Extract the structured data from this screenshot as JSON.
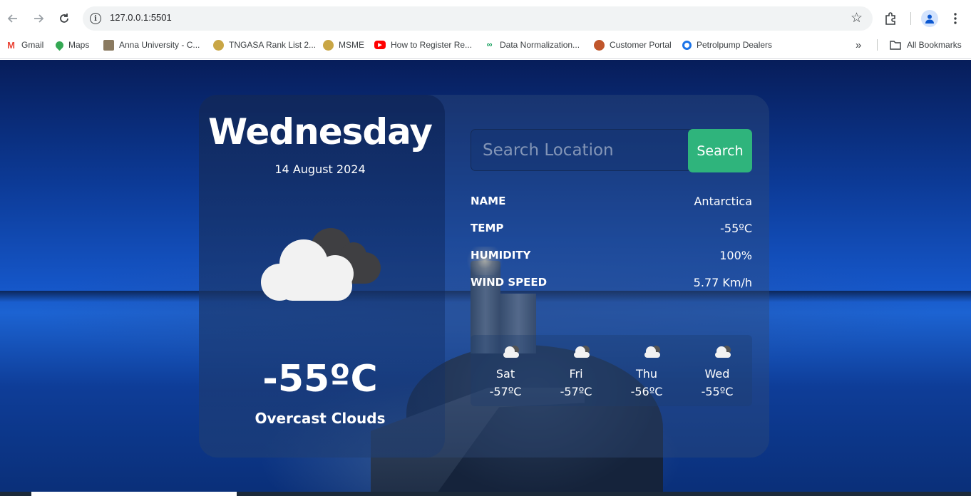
{
  "browser": {
    "url": "127.0.0.1:5501",
    "bookmarks": [
      {
        "label": "Gmail",
        "icon": "gmail-icon",
        "color": "#ea4335"
      },
      {
        "label": "Maps",
        "icon": "maps-icon",
        "color": "#34a853"
      },
      {
        "label": "Anna University - C...",
        "icon": "anna-university-icon",
        "color": "#7a6a4f"
      },
      {
        "label": "TNGASA Rank List 2...",
        "icon": "tngasa-icon",
        "color": "#b08d3a"
      },
      {
        "label": "MSME",
        "icon": "msme-icon",
        "color": "#b08d3a"
      },
      {
        "label": "How to Register Re...",
        "icon": "youtube-icon",
        "color": "#ff0000"
      },
      {
        "label": "Data Normalization...",
        "icon": "data-normalization-icon",
        "color": "#0f9d58"
      },
      {
        "label": "Customer Portal",
        "icon": "customer-portal-icon",
        "color": "#c0562b"
      },
      {
        "label": "Petrolpump Dealers",
        "icon": "petrolpump-icon",
        "color": "#1a73e8"
      }
    ],
    "all_bookmarks_label": "All Bookmarks"
  },
  "weather": {
    "day": "Wednesday",
    "date": "14 August 2024",
    "temperature": "-55ºC",
    "condition": "Overcast Clouds",
    "search": {
      "placeholder": "Search Location",
      "button_label": "Search"
    },
    "details": [
      {
        "key": "NAME",
        "value": "Antarctica"
      },
      {
        "key": "TEMP",
        "value": "-55ºC"
      },
      {
        "key": "HUMIDITY",
        "value": "100%"
      },
      {
        "key": "WIND SPEED",
        "value": "5.77 Km/h"
      }
    ],
    "forecast": [
      {
        "day": "Sat",
        "temp": "-57ºC"
      },
      {
        "day": "Fri",
        "temp": "-57ºC"
      },
      {
        "day": "Thu",
        "temp": "-56ºC"
      },
      {
        "day": "Wed",
        "temp": "-55ºC"
      }
    ]
  },
  "colors": {
    "search_button": "#2fb47c",
    "text": "#ffffff"
  }
}
